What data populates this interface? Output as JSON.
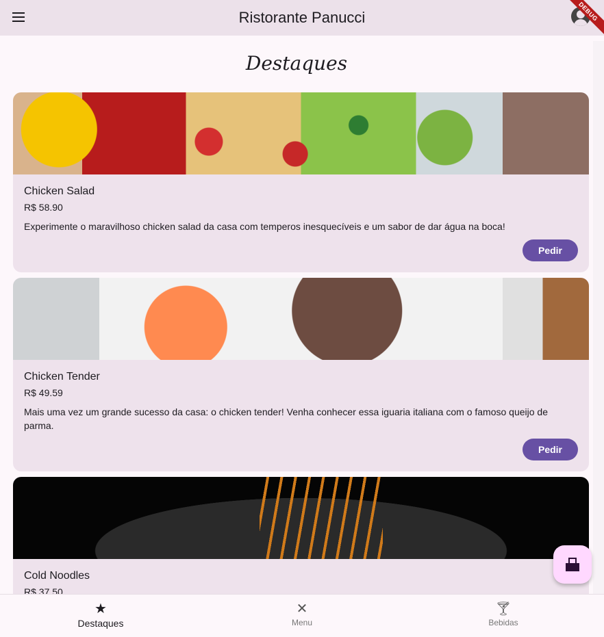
{
  "appbar": {
    "title": "Ristorante Panucci",
    "debug_label": "DEBUG",
    "icons": {
      "menu": "hamburger-menu-icon",
      "account": "account-circle-icon"
    }
  },
  "section": {
    "title": "Destaques"
  },
  "cards": [
    {
      "name": "Chicken Salad",
      "price": "R$ 58.90",
      "description": "Experimente o maravilhoso chicken salad da casa com temperos inesquecíveis e um sabor de dar água na boca!",
      "button": "Pedir"
    },
    {
      "name": "Chicken Tender",
      "price": "R$ 49.59",
      "description": "Mais uma vez um grande sucesso da casa: o chicken tender! Venha conhecer essa iguaria italiana com o famoso queijo de parma.",
      "button": "Pedir"
    },
    {
      "name": "Cold Noodles",
      "price": "R$ 37.50"
    }
  ],
  "fab": {
    "icon": "point-of-sale-icon"
  },
  "bottom_nav": {
    "items": [
      {
        "label": "Destaques",
        "icon": "star-icon",
        "active": true
      },
      {
        "label": "Menu",
        "icon": "restaurant-icon",
        "active": false
      },
      {
        "label": "Bebidas",
        "icon": "local-bar-icon",
        "active": false
      }
    ]
  },
  "colors": {
    "primary": "#6750a4",
    "appbar": "#ece1ea",
    "card": "#eee2ec",
    "fab": "#ffd8ff",
    "background": "#fdf7fb"
  }
}
